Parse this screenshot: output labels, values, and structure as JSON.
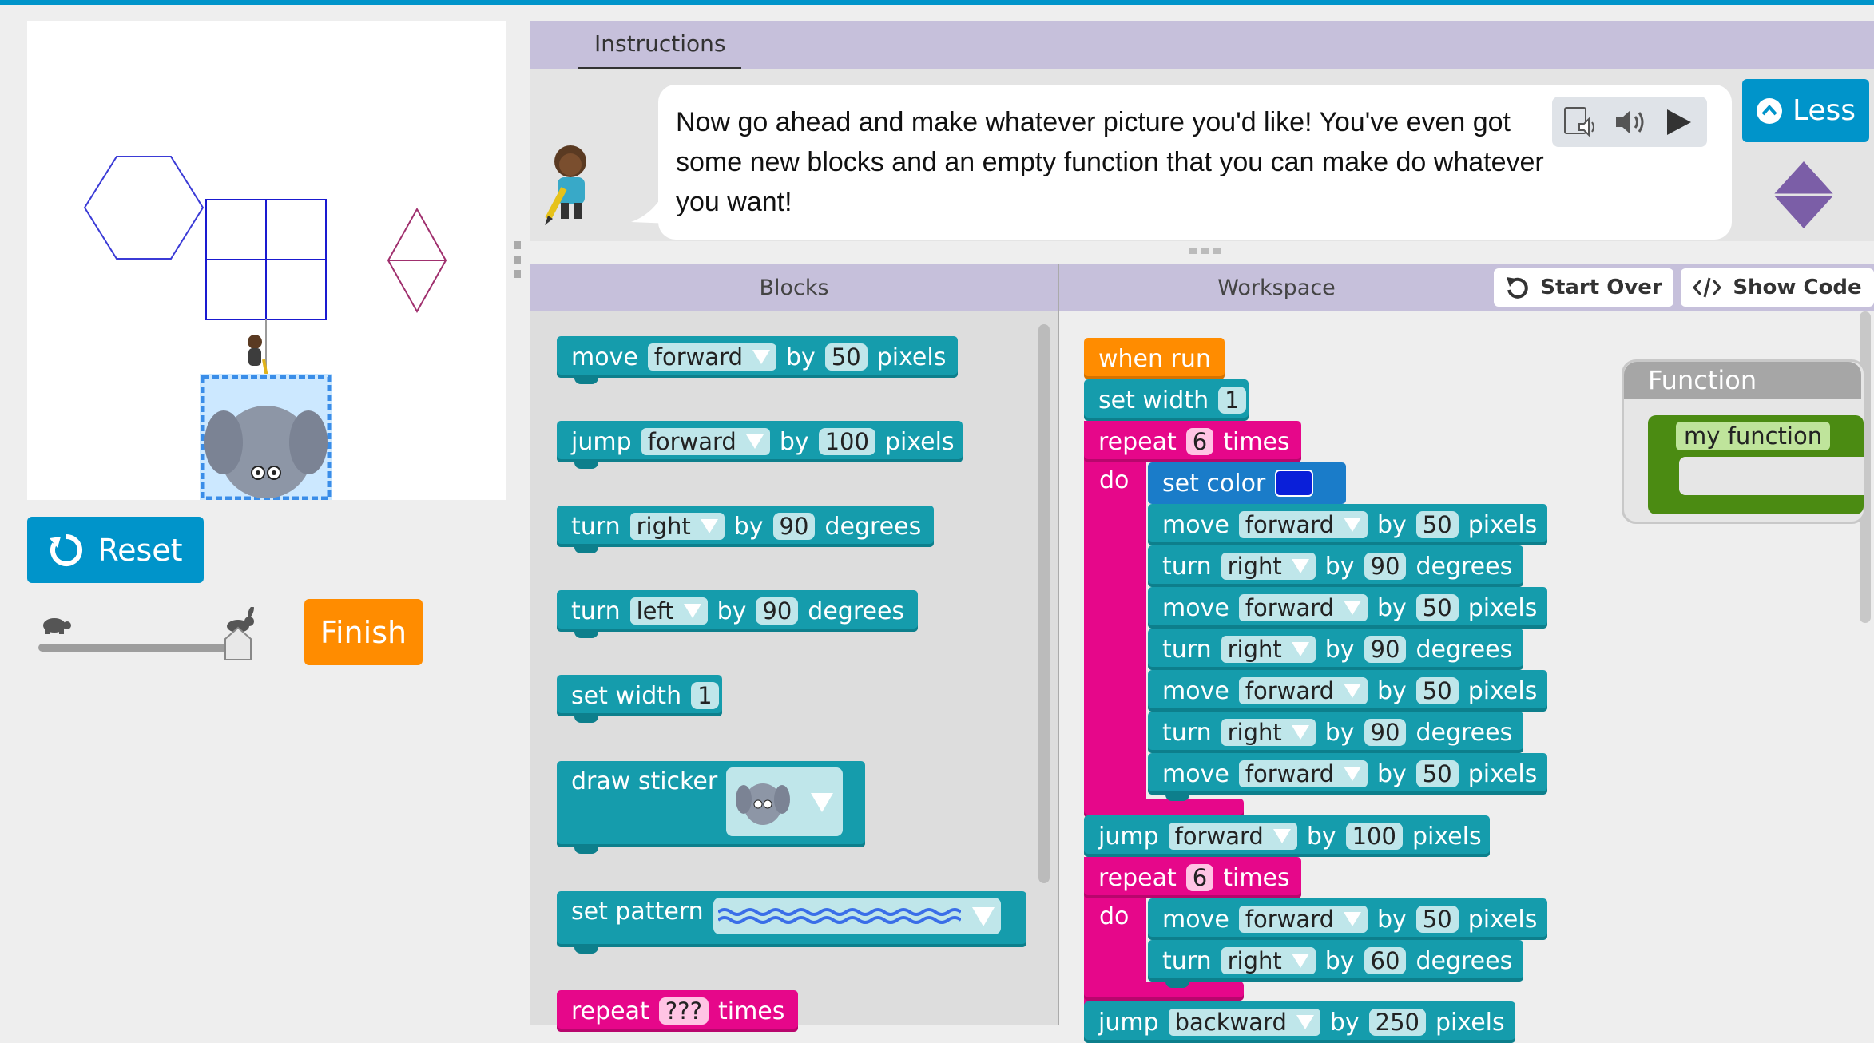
{
  "controls": {
    "reset_label": "Reset",
    "finish_label": "Finish",
    "speed_slider_value": 1.0
  },
  "instructions": {
    "tab_label": "Instructions",
    "text": "Now go ahead and make whatever picture you'd like! You've even got some new blocks and an empty function that you can make do whatever you want!",
    "less_label": "Less"
  },
  "panels": {
    "blocks_title": "Blocks",
    "workspace_title": "Workspace",
    "start_over_label": "Start Over",
    "show_code_label": "Show Code"
  },
  "toolbox": [
    {
      "parts": [
        "move",
        "forward",
        "by",
        "50",
        "pixels"
      ]
    },
    {
      "parts": [
        "jump",
        "forward",
        "by",
        "100",
        "pixels"
      ]
    },
    {
      "parts": [
        "turn",
        "right",
        "by",
        "90",
        "degrees"
      ]
    },
    {
      "parts": [
        "turn",
        "left",
        "by",
        "90",
        "degrees"
      ]
    },
    {
      "parts": [
        "set width",
        "1"
      ]
    },
    {
      "parts": [
        "draw sticker"
      ]
    },
    {
      "parts": [
        "set pattern"
      ]
    },
    {
      "parts": [
        "repeat",
        "???",
        "times"
      ]
    }
  ],
  "workspace": {
    "when_run": "when run",
    "set_width": {
      "label": "set width",
      "value": "1"
    },
    "repeat1": {
      "label": "repeat",
      "count": "6",
      "times": "times",
      "do": "do"
    },
    "set_color": {
      "label": "set color",
      "color": "#0a1fd9"
    },
    "inner1": [
      {
        "verb": "move",
        "dir": "forward",
        "by": "by",
        "value": "50",
        "unit": "pixels"
      },
      {
        "verb": "turn",
        "dir": "right",
        "by": "by",
        "value": "90",
        "unit": "degrees"
      },
      {
        "verb": "move",
        "dir": "forward",
        "by": "by",
        "value": "50",
        "unit": "pixels"
      },
      {
        "verb": "turn",
        "dir": "right",
        "by": "by",
        "value": "90",
        "unit": "degrees"
      },
      {
        "verb": "move",
        "dir": "forward",
        "by": "by",
        "value": "50",
        "unit": "pixels"
      },
      {
        "verb": "turn",
        "dir": "right",
        "by": "by",
        "value": "90",
        "unit": "degrees"
      },
      {
        "verb": "move",
        "dir": "forward",
        "by": "by",
        "value": "50",
        "unit": "pixels"
      }
    ],
    "jump1": {
      "verb": "jump",
      "dir": "forward",
      "by": "by",
      "value": "100",
      "unit": "pixels"
    },
    "repeat2": {
      "label": "repeat",
      "count": "6",
      "times": "times",
      "do": "do"
    },
    "inner2": [
      {
        "verb": "move",
        "dir": "forward",
        "by": "by",
        "value": "50",
        "unit": "pixels"
      },
      {
        "verb": "turn",
        "dir": "right",
        "by": "by",
        "value": "60",
        "unit": "degrees"
      }
    ],
    "jump2": {
      "verb": "jump",
      "dir": "backward",
      "by": "by",
      "value": "250",
      "unit": "pixels"
    }
  },
  "function_flyout": {
    "title": "Function",
    "block_label": "my function"
  },
  "colors": {
    "accent": "#0094ca",
    "finish": "#ff8c00",
    "motion_block": "#159cac",
    "loop_block": "#e6078a",
    "event_block": "#ff8c00",
    "function_block": "#4b8b12",
    "panel_header": "#c6c0db"
  }
}
